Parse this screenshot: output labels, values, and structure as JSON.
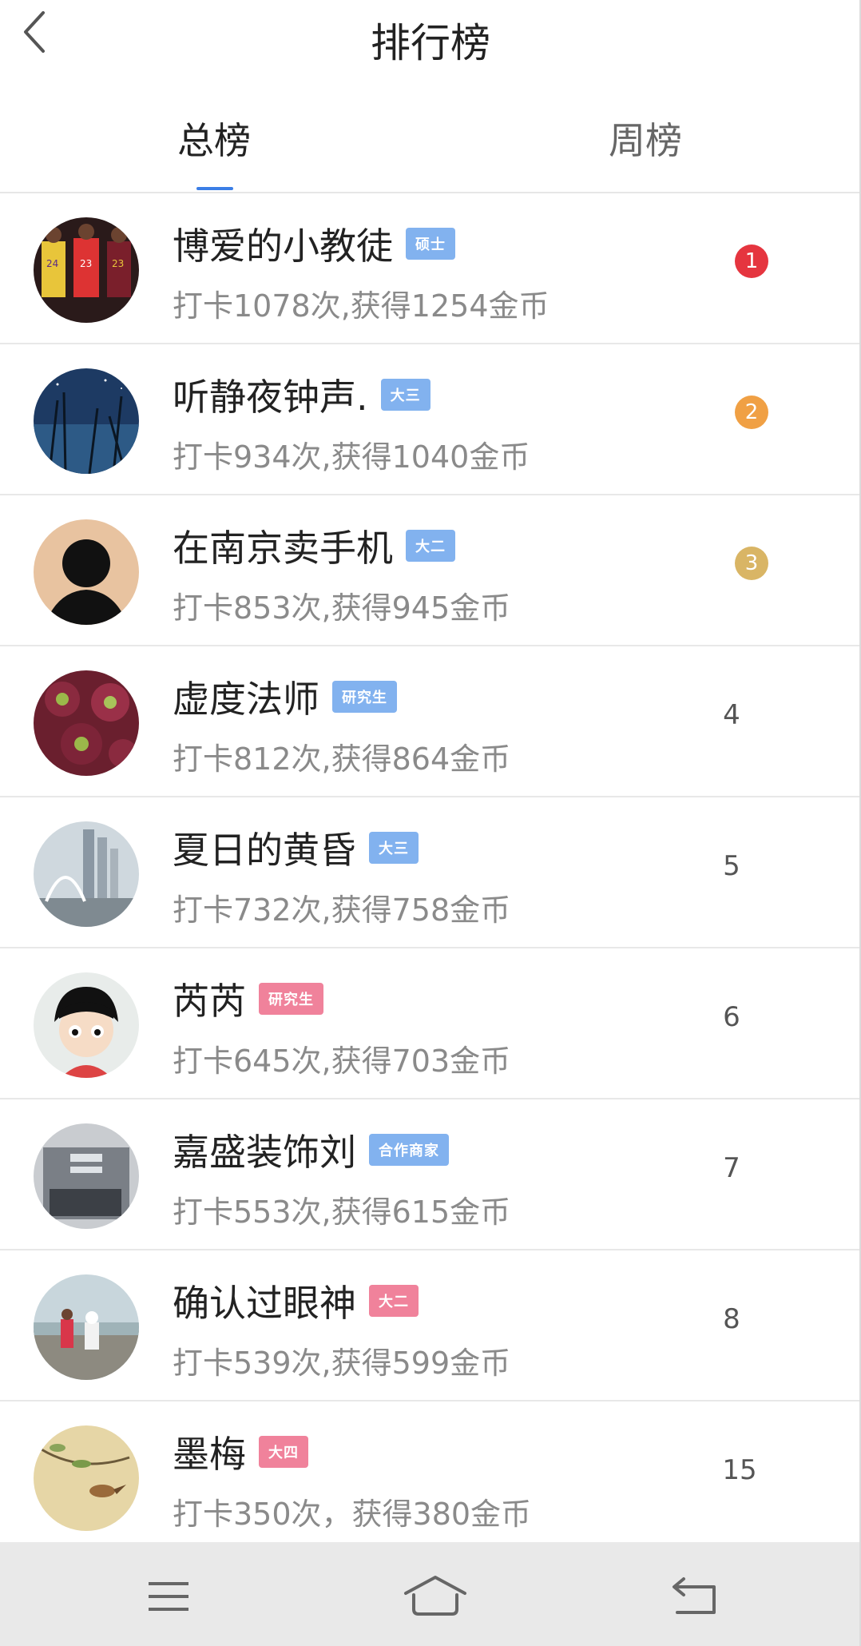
{
  "header": {
    "title": "排行榜",
    "back_icon": "back-arrow-icon"
  },
  "tabs": [
    {
      "label": "总榜",
      "active": true
    },
    {
      "label": "周榜",
      "active": false
    }
  ],
  "colors": {
    "accent": "#3b7ee6",
    "badge_blue": "#82b2ef",
    "badge_pink": "#f0829b",
    "rank1": "#e5353f",
    "rank2": "#f0a044",
    "rank3": "#d9b565"
  },
  "list": [
    {
      "name": "博爱的小教徒",
      "badge": "硕士",
      "badge_color": "blue",
      "desc": "打卡1078次,获得1254金币",
      "rank": "1",
      "medal": "rank1",
      "avatar": "basketball-players"
    },
    {
      "name": "听静夜钟声.",
      "badge": "大三",
      "badge_color": "blue",
      "desc": "打卡934次,获得1040金币",
      "rank": "2",
      "medal": "rank2",
      "avatar": "night-reeds"
    },
    {
      "name": "在南京卖手机",
      "badge": "大二",
      "badge_color": "blue",
      "desc": "打卡853次,获得945金币",
      "rank": "3",
      "medal": "rank3",
      "avatar": "silhouette"
    },
    {
      "name": "虚度法师",
      "badge": "研究生",
      "badge_color": "blue",
      "desc": "打卡812次,获得864金币",
      "rank": "4",
      "medal": "",
      "avatar": "succulents"
    },
    {
      "name": "夏日的黄昏",
      "badge": "大三",
      "badge_color": "blue",
      "desc": "打卡732次,获得758金币",
      "rank": "5",
      "medal": "",
      "avatar": "city-bridge"
    },
    {
      "name": "芮芮",
      "badge": "研究生",
      "badge_color": "pink",
      "desc": "打卡645次,获得703金币",
      "rank": "6",
      "medal": "",
      "avatar": "cartoon-girl"
    },
    {
      "name": "嘉盛装饰刘",
      "badge": "合作商家",
      "badge_color": "blue",
      "desc": "打卡553次,获得615金币",
      "rank": "7",
      "medal": "",
      "avatar": "storefront"
    },
    {
      "name": "确认过眼神",
      "badge": "大二",
      "badge_color": "pink",
      "desc": "打卡539次,获得599金币",
      "rank": "8",
      "medal": "",
      "avatar": "riverside-people"
    },
    {
      "name": "墨梅",
      "badge": "大四",
      "badge_color": "pink",
      "desc": "打卡350次，获得380金币",
      "rank": "15",
      "medal": "",
      "avatar": "bird-painting"
    }
  ],
  "nav": {
    "menu_icon": "menu-icon",
    "home_icon": "home-icon",
    "back_icon": "return-icon"
  }
}
